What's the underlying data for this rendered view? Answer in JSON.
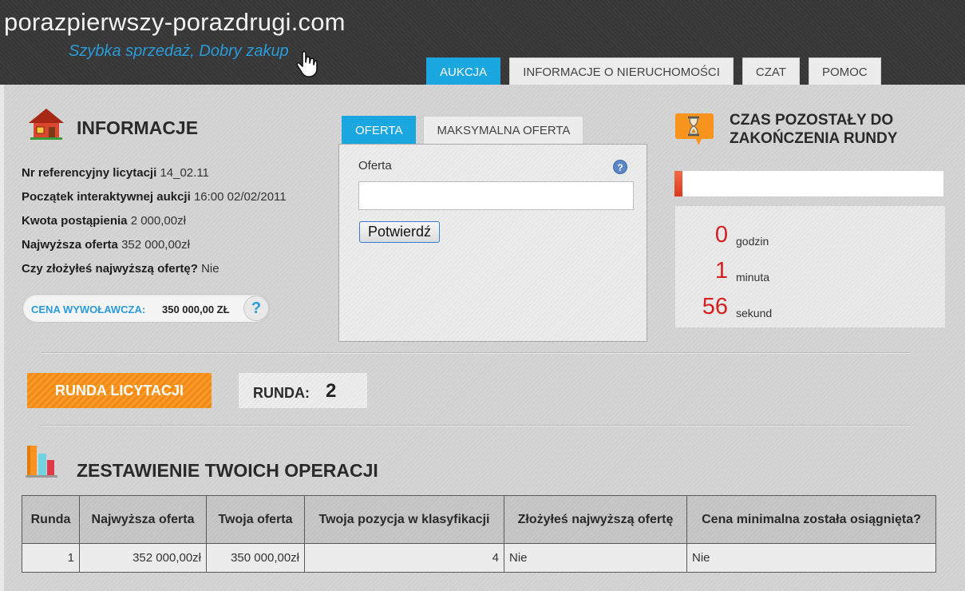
{
  "header": {
    "site_title": "porazpierwszy-porazdrugi.com",
    "tagline": "Szybka sprzedaż, Dobry zakup",
    "nav": [
      {
        "label": "AUKCJA",
        "active": true
      },
      {
        "label": "INFORMACJE O NIERUCHOMOŚCI",
        "active": false
      },
      {
        "label": "CZAT",
        "active": false
      },
      {
        "label": "POMOC",
        "active": false
      }
    ]
  },
  "info": {
    "title": "INFORMACJE",
    "rows": [
      {
        "label": "Nr referencyjny licytacji",
        "value": "14_02.11"
      },
      {
        "label": "Początek interaktywnej aukcji",
        "value": "16:00 02/02/2011"
      },
      {
        "label": "Kwota postąpienia",
        "value": "2 000,00zł"
      },
      {
        "label": "Najwyższa oferta",
        "value": "352 000,00zł"
      },
      {
        "label": "Czy złożyłeś najwyższą ofertę?",
        "value": "Nie"
      }
    ],
    "starting_price_label": "CENA WYWOŁAWCZA:",
    "starting_price_value": "350 000,00 ZŁ",
    "help_glyph": "?"
  },
  "offer": {
    "tabs": [
      {
        "label": "OFERTA",
        "active": true
      },
      {
        "label": "MAKSYMALNA OFERTA",
        "active": false
      }
    ],
    "field_label": "Oferta",
    "field_value": "",
    "help_glyph": "?",
    "submit_label": "Potwierdź"
  },
  "countdown": {
    "title": "CZAS POZOSTAŁY DO ZAKOŃCZENIA RUNDY",
    "progress_fraction": 0.03,
    "progress_color": "#e04a2a",
    "hours_value": "0",
    "hours_unit": "godzin",
    "minutes_value": "1",
    "minutes_unit": "minuta",
    "seconds_value": "56",
    "seconds_unit": "sekund"
  },
  "round": {
    "button_label": "RUNDA LICYTACJI",
    "label": "RUNDA:",
    "value": "2"
  },
  "operations": {
    "title": "ZESTAWIENIE TWOICH OPERACJI",
    "columns": [
      "Runda",
      "Najwyższa oferta",
      "Twoja oferta",
      "Twoja pozycja w klasyfikacji",
      "Złożyłeś najwyższą ofertę",
      "Cena minimalna została osiągnięta?"
    ],
    "rows": [
      [
        "1",
        "352 000,00zł",
        "350 000,00zł",
        "4",
        "Nie",
        "Nie"
      ]
    ]
  },
  "colors": {
    "accent_blue": "#1aa7e0",
    "accent_orange": "#f7941d",
    "countdown_red": "#d42020"
  },
  "icons": {
    "house": "house-icon",
    "hourglass": "hourglass-icon",
    "bar_chart": "bar-chart-icon",
    "hand_pointer": "hand-pointer-icon"
  }
}
